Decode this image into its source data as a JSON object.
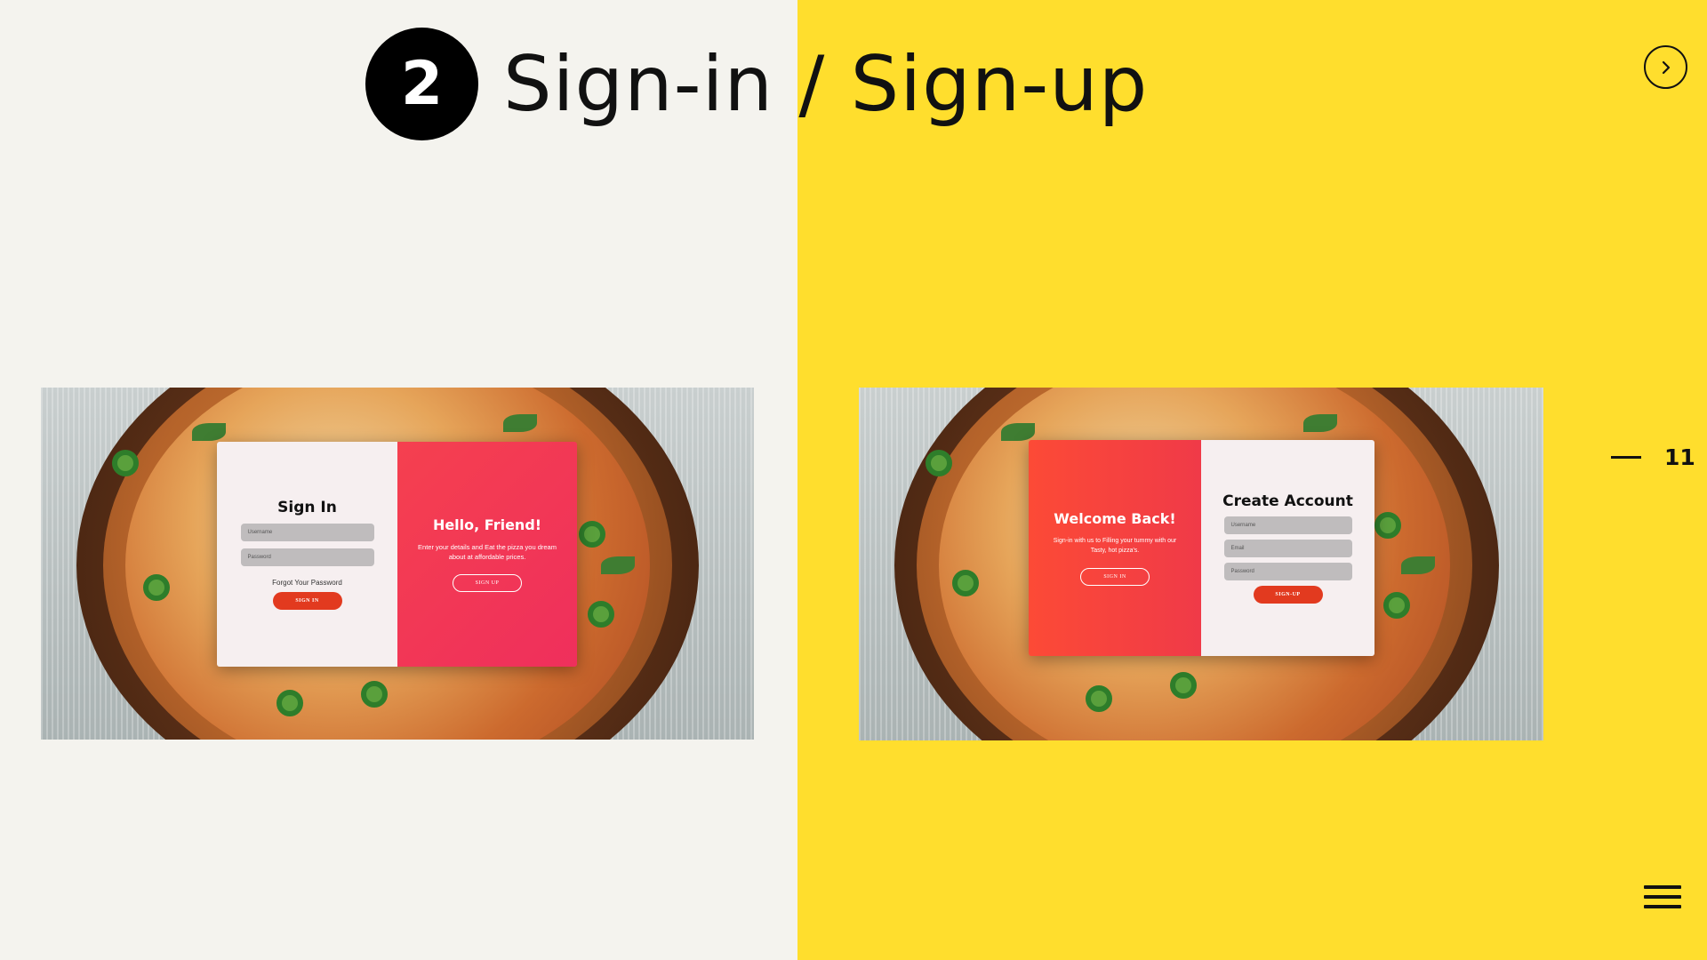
{
  "header": {
    "step_number": "2",
    "title": "Sign-in / Sign-up"
  },
  "navigation": {
    "next_icon": "chevron-right-icon",
    "page_number": "11",
    "menu_icon": "hamburger-menu-icon"
  },
  "colors": {
    "left_background": "#f4f3ee",
    "right_background": "#ffde2d",
    "accent_red": "#e23a1f",
    "gradient_start": "#f5404f",
    "gradient_end": "#ef2f5c"
  },
  "signin_screenshot": {
    "form_title": "Sign In",
    "username_placeholder": "Username",
    "password_placeholder": "Password",
    "forgot_password": "Forgot Your Password",
    "signin_button": "SIGN IN",
    "panel_title": "Hello, Friend!",
    "panel_text": "Enter your details and Eat the pizza you dream about at affordable prices.",
    "signup_button": "SIGN UP"
  },
  "signup_screenshot": {
    "panel_title": "Welcome Back!",
    "panel_text": "Sign-in with us to Filling your tummy with our Tasty, hot pizza's.",
    "signin_button": "SIGN IN",
    "form_title": "Create Account",
    "username_placeholder": "Username",
    "email_placeholder": "Email",
    "password_placeholder": "Password",
    "signup_button": "SIGN-UP"
  }
}
